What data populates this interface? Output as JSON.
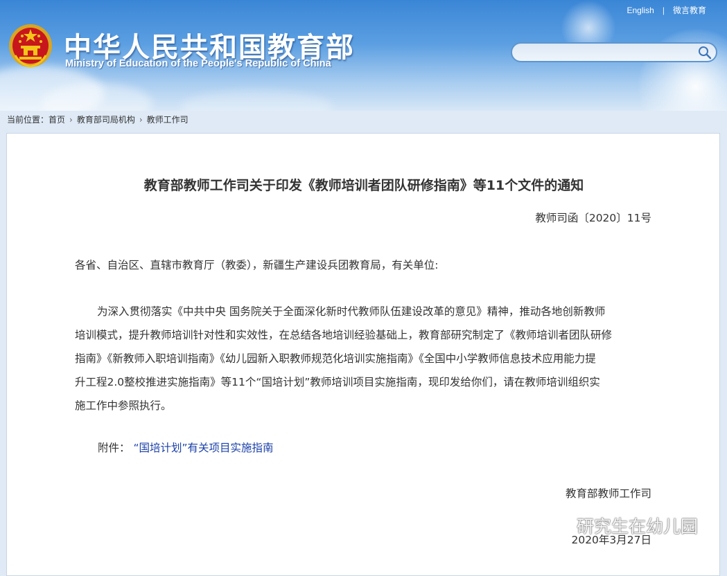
{
  "header": {
    "title_cn": "中华人民共和国教育部",
    "title_en": "Ministry of Education of the People's Republic of China",
    "links": {
      "english": "English",
      "weibo": "微言教育"
    },
    "search": {
      "placeholder": ""
    }
  },
  "breadcrumb": {
    "prefix": "当前位置：",
    "items": [
      "首页",
      "教育部司局机构",
      "教师工作司"
    ]
  },
  "document": {
    "title": "教育部教师工作司关于印发《教师培训者团队研修指南》等11个文件的通知",
    "number": "教师司函〔2020〕11号",
    "salutation": "各省、自治区、直辖市教育厅（教委），新疆生产建设兵团教育局，有关单位:",
    "body_lines": [
      "为深入贯彻落实《中共中央 国务院关于全面深化新时代教师队伍建设改革的意见》精神，推动各地创新教师",
      "培训模式，提升教师培训针对性和实效性，在总结各地培训经验基础上，教育部研究制定了《教师培训者团队研修",
      "指南》《新教师入职培训指南》《幼儿园新入职教师规范化培训实施指南》《全国中小学教师信息技术应用能力提",
      "升工程2.0整校推进实施指南》等11个“国培计划”教师培训项目实施指南，现印发给你们，请在教师培训组织实",
      "施工作中参照执行。"
    ],
    "attachment_label": "附件：",
    "attachment_link": "“国培计划”有关项目实施指南",
    "signer": "教育部教师工作司",
    "date": "2020年3月27日"
  },
  "watermark": {
    "text": "研究生在幼儿园"
  },
  "colors": {
    "link_blue": "#1a3fa8",
    "header_blue": "#3a86d6",
    "text": "#333333"
  }
}
